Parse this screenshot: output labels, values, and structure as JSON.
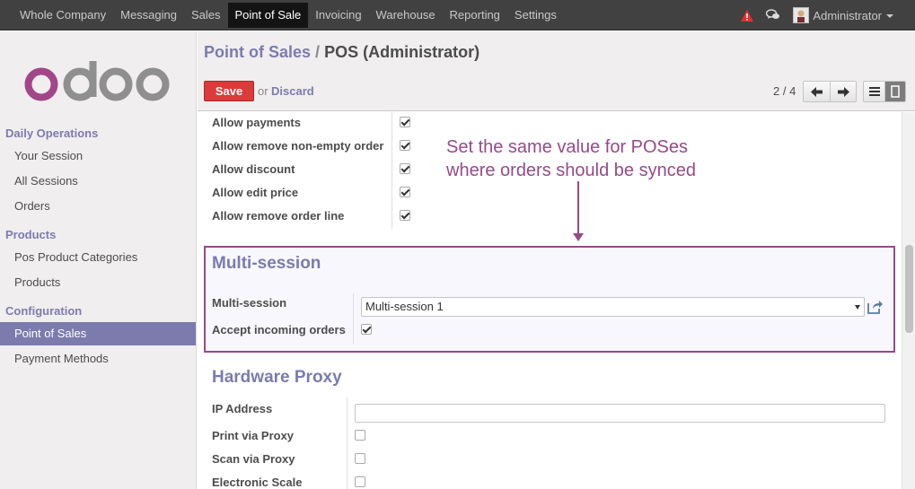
{
  "topbar": {
    "menu": [
      {
        "label": "Whole Company",
        "active": false
      },
      {
        "label": "Messaging",
        "active": false
      },
      {
        "label": "Sales",
        "active": false
      },
      {
        "label": "Point of Sale",
        "active": true
      },
      {
        "label": "Invoicing",
        "active": false
      },
      {
        "label": "Warehouse",
        "active": false
      },
      {
        "label": "Reporting",
        "active": false
      },
      {
        "label": "Settings",
        "active": false
      }
    ],
    "user": "Administrator",
    "icons": [
      "warning-icon",
      "chat-icon",
      "avatar",
      "caret-down-icon"
    ]
  },
  "sidebar": {
    "sections": [
      {
        "title": "Daily Operations",
        "items": [
          "Your Session",
          "All Sessions",
          "Orders"
        ]
      },
      {
        "title": "Products",
        "items": [
          "Pos Product Categories",
          "Products"
        ]
      },
      {
        "title": "Configuration",
        "items": [
          "Point of Sales",
          "Payment Methods"
        ]
      }
    ],
    "active_item": "Point of Sales"
  },
  "control_panel": {
    "breadcrumb_parent": "Point of Sales",
    "breadcrumb_sep": "/",
    "breadcrumb_current": "POS (Administrator)",
    "save_label": "Save",
    "or_label": "or",
    "discard_label": "Discard",
    "pager": "2 / 4"
  },
  "form": {
    "allow_rows": [
      {
        "label": "Allow payments",
        "checked": true
      },
      {
        "label": "Allow remove non-empty order",
        "checked": true
      },
      {
        "label": "Allow discount",
        "checked": true
      },
      {
        "label": "Allow edit price",
        "checked": true
      },
      {
        "label": "Allow remove order line",
        "checked": true
      }
    ],
    "annotation_line1": "Set the same value for POSes",
    "annotation_line2": "where orders should be synced",
    "multi_session": {
      "title": "Multi-session",
      "field_label": "Multi-session",
      "field_value": "Multi-session 1",
      "accept_label": "Accept incoming orders",
      "accept_checked": true
    },
    "hardware_proxy": {
      "title": "Hardware Proxy",
      "ip_label": "IP Address",
      "ip_value": "",
      "rows": [
        {
          "label": "Print via Proxy",
          "checked": false
        },
        {
          "label": "Scan via Proxy",
          "checked": false
        },
        {
          "label": "Electronic Scale",
          "checked": false
        }
      ]
    }
  },
  "colors": {
    "brand": "#7c7bad",
    "save": "#dc3b3b",
    "annotation": "#944a8a",
    "topbar": "#414141",
    "logo_o": "#a24689",
    "logo_doo": "#8f8f8f"
  }
}
